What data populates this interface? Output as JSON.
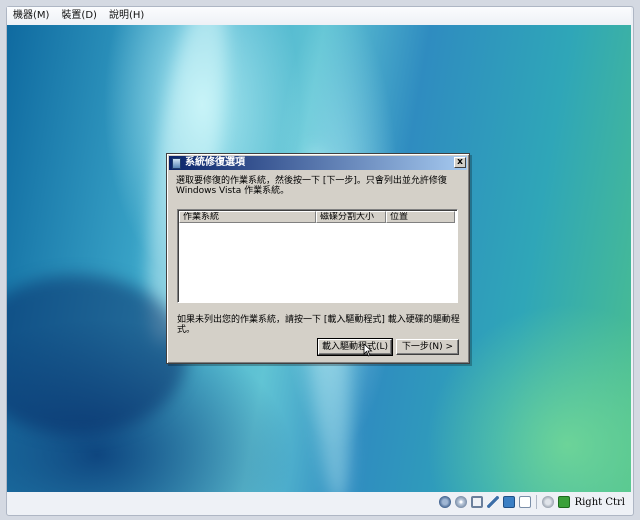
{
  "menubar": {
    "items": [
      {
        "label": "機器(M)"
      },
      {
        "label": "裝置(D)"
      },
      {
        "label": "說明(H)"
      }
    ]
  },
  "dialog": {
    "title": "系統修復選項",
    "close_label": "x",
    "description": "選取要修復的作業系統，然後按一下 [下一步]。只會列出並允許修復 Windows Vista 作業系統。",
    "list": {
      "columns": [
        "作業系統",
        "磁碟分割大小",
        "位置"
      ],
      "rows": []
    },
    "note": "如果未列出您的作業系統，請按一下 [載入驅動程式] 載入硬碟的驅動程式。",
    "buttons": {
      "load_driver": "載入驅動程式(L)",
      "next": "下一步(N) >"
    }
  },
  "statusbar": {
    "icons": [
      "disk-icon",
      "cd-icon",
      "usb-icon",
      "pen-icon",
      "folder-icon",
      "display-icon",
      "record-icon",
      "mouse-integration-icon"
    ],
    "host_key": "Right Ctrl"
  },
  "colors": {
    "titlebar_start": "#0a246a",
    "titlebar_end": "#a6caf0",
    "dialog_bg": "#d4d0c8"
  }
}
